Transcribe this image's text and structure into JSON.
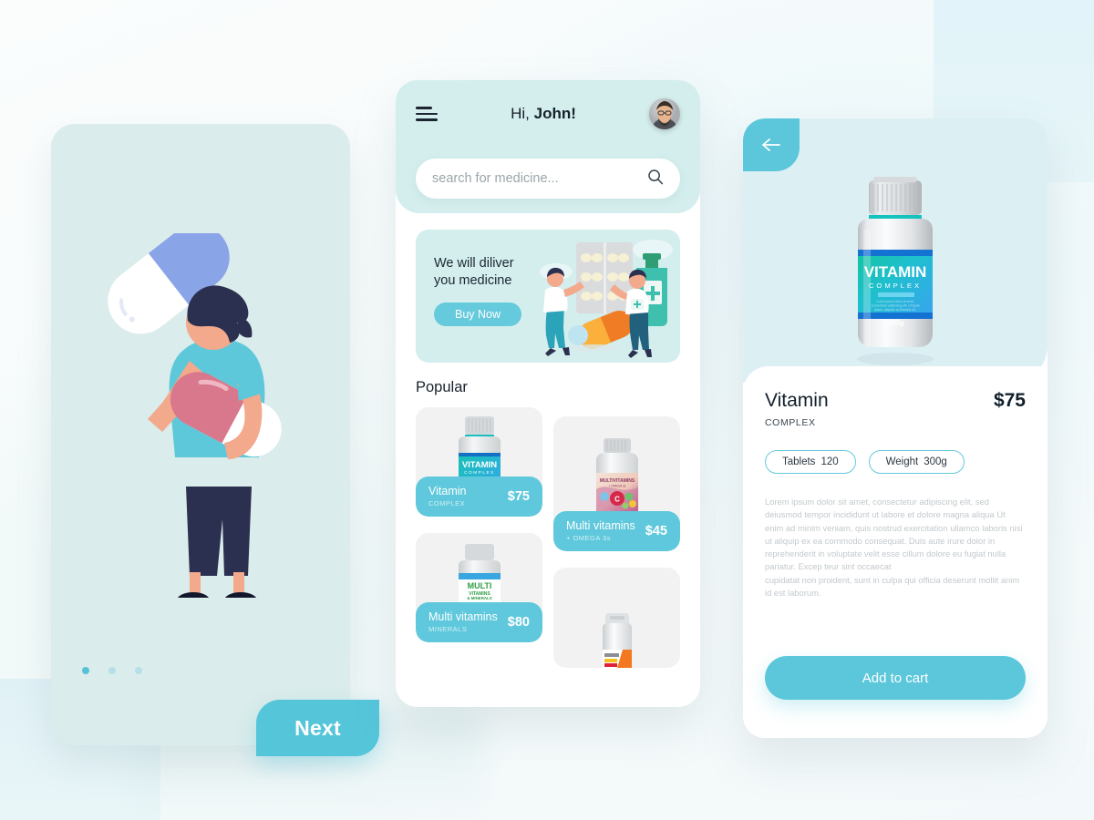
{
  "colors": {
    "accent": "#5cc7db",
    "panel_mint": "#daeceb",
    "header_mint": "#d4eeed",
    "hero_blue": "#dcf0f4",
    "card_grey": "#f2f2f2",
    "text_dark": "#12202c",
    "text_muted": "#c3c9cd"
  },
  "onboarding": {
    "illustration_name": "woman-holding-capsules-illustration",
    "dots": [
      {
        "active": true
      },
      {
        "active": false
      },
      {
        "active": false
      }
    ],
    "next_label": "Next"
  },
  "home": {
    "menu_icon": "hamburger-menu-icon",
    "greeting_prefix": "Hi, ",
    "greeting_name": "John!",
    "avatar_icon": "user-avatar",
    "search": {
      "placeholder": "search for medicine...",
      "value": "",
      "icon": "search-icon"
    },
    "promo": {
      "title_line1": "We will diliver",
      "title_line2": "you medicine",
      "cta_label": "Buy Now",
      "illustration_name": "pharmacists-with-medicine-illustration"
    },
    "popular_heading": "Popular",
    "products": [
      {
        "name": "Vitamin",
        "subtitle": "COMPLEX",
        "price": "$75",
        "thumb": "vitamin-complex-bottle"
      },
      {
        "name": "Multi vitamins",
        "subtitle": "+ OMEGA 3s",
        "price": "$45",
        "thumb": "multivitamins-omega-bottle"
      },
      {
        "name": "Multi vitamins",
        "subtitle": "MINERALS",
        "price": "$80",
        "thumb": "multivitamins-minerals-bottle"
      },
      {
        "name": "",
        "subtitle": "",
        "price": "",
        "thumb": "orange-supplement-bottle"
      }
    ]
  },
  "detail": {
    "back_icon": "arrow-left-icon",
    "hero_product": {
      "label_title": "VITAMIN",
      "label_subtitle": "COMPLEX",
      "label_weight": "300g"
    },
    "title": "Vitamin",
    "subtitle": "COMPLEX",
    "price": "$75",
    "chips": [
      {
        "label": "Tablets",
        "value": "120"
      },
      {
        "label": "Weight",
        "value": "300g"
      }
    ],
    "description_p1": "Lorem ipsum dolor sit amet, consectetur adipiscing elit, sed deiusmod tempor incididunt ut labore et dolore magna aliqua Ut enim ad minim veniam, quis nostrud exercitation ullamco laboris nisi ut aliquip ex ea commodo consequat. Duis aute irure dolor in reprehenderit in voluptate velit esse cillum dolore eu fugiat nulla pariatur. Excep teur sint occaecat",
    "description_p2": "cupidatat non proident, sunt in culpa qui officia deserunt mollit anim id est laborum.",
    "add_to_cart_label": "Add to cart"
  }
}
